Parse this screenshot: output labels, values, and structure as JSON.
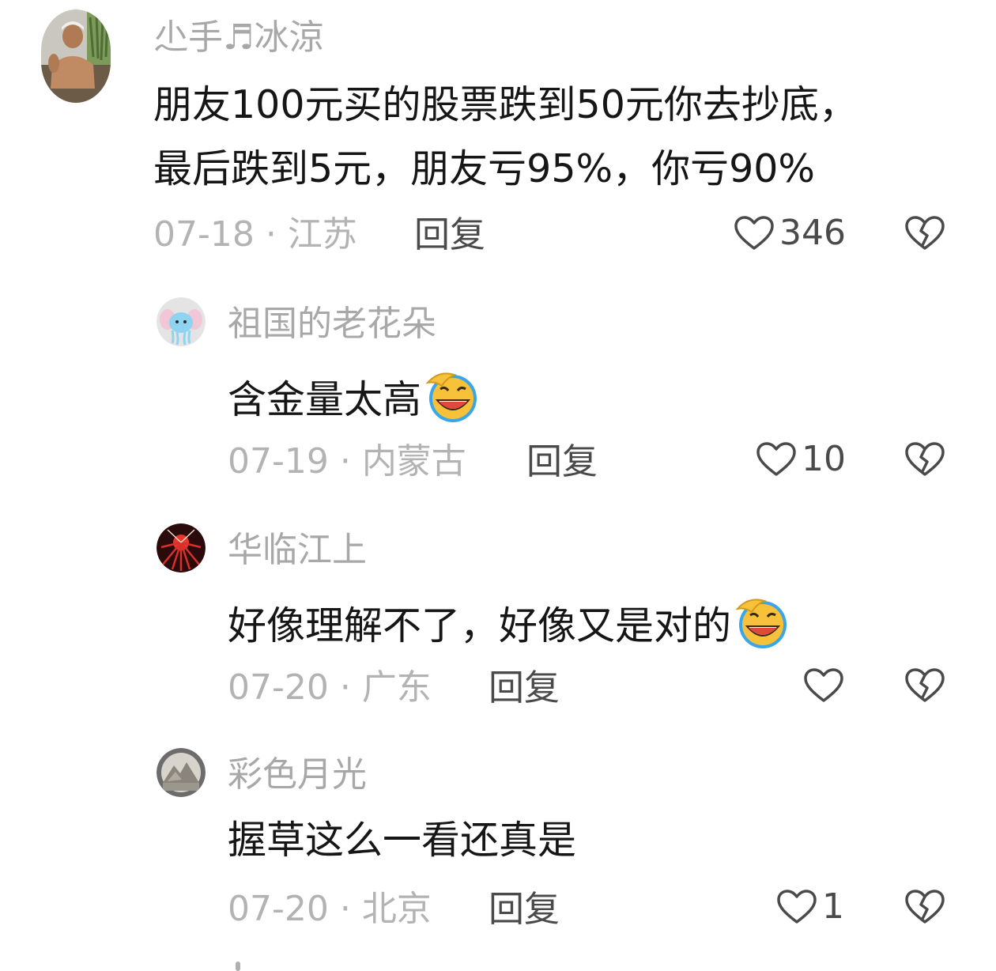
{
  "comments": [
    {
      "username": "尐手♬冰涼",
      "text_lines": [
        "朋友100元买的股票跌到50元你去抄底，",
        "最后跌到5元，朋友亏95%，你亏90%"
      ],
      "date_location": "07-18 · 江苏",
      "reply_label": "回复",
      "likes": "346",
      "avatar_icon": "man-with-plants-avatar"
    },
    {
      "username": "祖国的老花朵",
      "text": "含金量太高",
      "emoji": "laughing-crying-emoji",
      "date_location": "07-19 · 内蒙古",
      "reply_label": "回复",
      "likes": "10",
      "avatar_icon": "cartoon-jellyfish-avatar"
    },
    {
      "username": "华临江上",
      "text": "好像理解不了，好像又是对的",
      "emoji": "laughing-crying-emoji",
      "date_location": "07-20 · 广东",
      "reply_label": "回复",
      "likes": "",
      "avatar_icon": "red-fireworks-avatar"
    },
    {
      "username": "彩色月光",
      "text": "握草这么一看还真是",
      "date_location": "07-20 · 北京",
      "reply_label": "回复",
      "likes": "1",
      "avatar_icon": "landscape-avatar"
    }
  ],
  "colors": {
    "username": "#a8a8a8",
    "text": "#161616",
    "meta": "#b3b3b3",
    "action": "#4a4a4a"
  }
}
